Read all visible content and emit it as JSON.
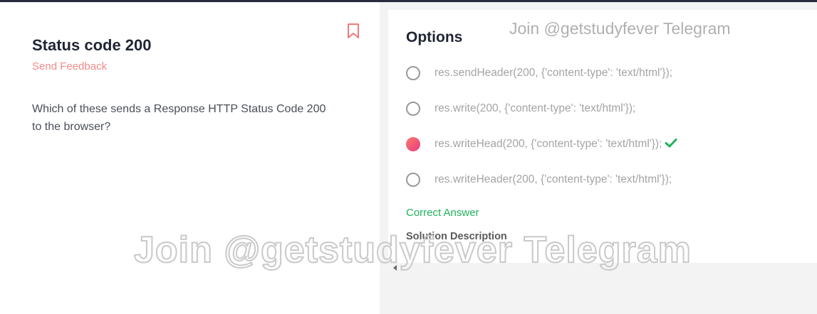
{
  "question": {
    "title": "Status code 200",
    "feedback_label": "Send Feedback",
    "text": "Which of these sends a Response HTTP Status Code 200 to the browser?"
  },
  "options_panel": {
    "title": "Options",
    "watermark": "Join @getstudyfever Telegram",
    "options": [
      {
        "text": "res.sendHeader(200, {'content-type': 'text/html'});",
        "selected": false
      },
      {
        "text": "res.write(200, {'content-type': 'text/html'});",
        "selected": false
      },
      {
        "text": "res.writeHead(200, {'content-type': 'text/html'});",
        "selected": true,
        "icon": "check-icon"
      },
      {
        "text": "res.writeHeader(200, {'content-type': 'text/html'});",
        "selected": false
      }
    ],
    "correct_label": "Correct Answer",
    "solution_label": "Solution Description"
  },
  "overlay": {
    "watermark": "Join @getstudyfever Telegram"
  },
  "colors": {
    "accent": "#f28a8a",
    "correct": "#20b25a",
    "selected_gradient": [
      "#f87b6b",
      "#e8448a"
    ]
  }
}
